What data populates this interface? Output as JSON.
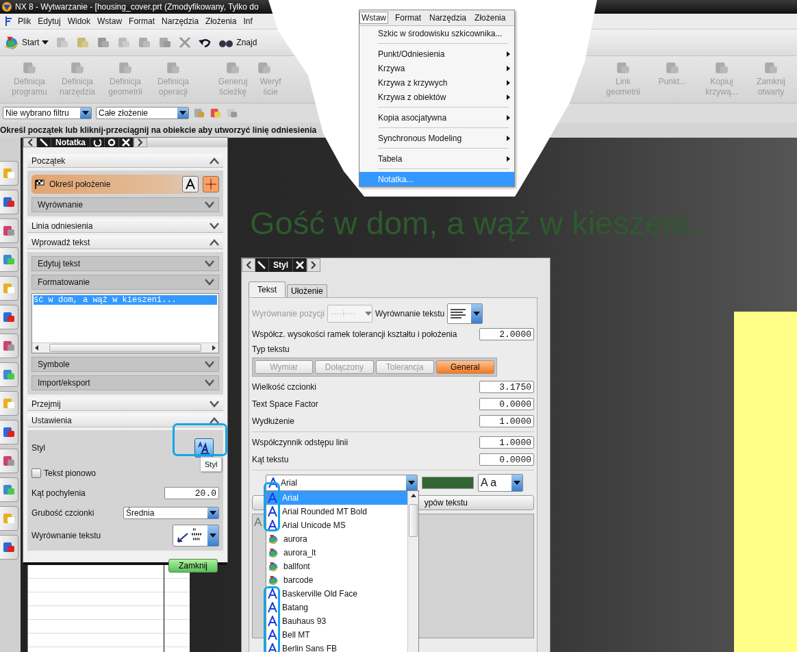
{
  "window": {
    "title": "NX 8 - Wytwarzanie - [housing_cover.prt (Zmodyfikowany, Tylko do"
  },
  "menu_bar": [
    "Plik",
    "Edytuj",
    "Widok",
    "Wstaw",
    "Format",
    "Narzędzia",
    "Złożenia",
    "Inf"
  ],
  "toolbar": {
    "start": "Start",
    "find": "Znajd"
  },
  "operations_toolbar": [
    {
      "label": "Definicja programu",
      "disabled": true
    },
    {
      "label": "Definicja narzędzia",
      "disabled": true
    },
    {
      "label": "Definicja geometrii",
      "disabled": true
    },
    {
      "label": "Definicja operacji",
      "disabled": true
    },
    {
      "label": "Generuj ścieżkę",
      "disabled": true
    },
    {
      "label": "Weryf ście",
      "disabled": true
    }
  ],
  "geometry_toolbar": [
    {
      "label": "Link geometrii",
      "disabled": true
    },
    {
      "label": "Punkt...",
      "disabled": true
    },
    {
      "label": "Kopiuj krzywą...",
      "disabled": true
    },
    {
      "label": "Zamknij otwarty",
      "disabled": true
    }
  ],
  "filter_bar": {
    "type_filter": "Nie wybrano filtru",
    "scope": "Całe złożenie"
  },
  "cue_line": "Określ początek lub kliknij-przeciągnij na obiekcie aby utworzyć linię odniesienia",
  "insert_menu": {
    "menu_bar": [
      {
        "label": "Wstaw",
        "selected": true
      },
      {
        "label": "Format",
        "selected": false
      },
      {
        "label": "Narzędzia",
        "selected": false
      },
      {
        "label": "Złożenia",
        "selected": false
      }
    ],
    "items": [
      {
        "kind": "item",
        "label": "Szkic w środowisku szkicownika...",
        "submenu": false,
        "selected": false
      },
      {
        "kind": "separator"
      },
      {
        "kind": "item",
        "label": "Punkt/Odniesienia",
        "submenu": true,
        "selected": false
      },
      {
        "kind": "item",
        "label": "Krzywa",
        "submenu": true,
        "selected": false
      },
      {
        "kind": "item",
        "label": "Krzywa z krzywych",
        "submenu": true,
        "selected": false
      },
      {
        "kind": "item",
        "label": "Krzywa z obiektów",
        "submenu": true,
        "selected": false
      },
      {
        "kind": "separator"
      },
      {
        "kind": "item",
        "label": "Kopia asocjatywna",
        "submenu": true,
        "selected": false
      },
      {
        "kind": "separator"
      },
      {
        "kind": "item",
        "label": "Synchronous Modeling",
        "submenu": true,
        "selected": false
      },
      {
        "kind": "separator"
      },
      {
        "kind": "item",
        "label": "Tabela",
        "submenu": true,
        "selected": false
      },
      {
        "kind": "separator"
      },
      {
        "kind": "item",
        "label": "Notatka...",
        "submenu": false,
        "selected": true
      }
    ]
  },
  "canvas_text": "Gość w dom, a wąż w kieszeni...",
  "note_dialog": {
    "title": "Notatka",
    "origin": {
      "title": "Początek",
      "expanded": true,
      "specify_location": "Określ położenie",
      "alignment": {
        "title": "Wyrównanie",
        "expanded": false
      }
    },
    "leader": {
      "title": "Linia odniesienia",
      "expanded": false
    },
    "text_input": {
      "title": "Wprowadź tekst",
      "expanded": true,
      "edit_text": {
        "title": "Edytuj tekst",
        "expanded": false
      },
      "formatting": {
        "title": "Formatowanie",
        "expanded": false
      },
      "text": "ść w dom, a wąż w kieszeni...",
      "symbols": {
        "title": "Symbole",
        "expanded": false
      },
      "import_export": {
        "title": "Import/eksport",
        "expanded": false
      }
    },
    "inherit": {
      "title": "Przejmij",
      "expanded": false
    },
    "settings": {
      "title": "Ustawienia",
      "expanded": true,
      "style_label": "Styl",
      "style_tooltip": "Styl",
      "vertical_text": {
        "label": "Tekst pionowo",
        "checked": false
      },
      "slant_angle": {
        "label": "Kąt pochylenia",
        "value": "20.0"
      },
      "font_weight": {
        "label": "Grubość czcionki",
        "value": "Średnia"
      },
      "text_alignment": {
        "label": "Wyrównanie tekstu"
      }
    },
    "close_button": "Zamknij"
  },
  "style_dialog": {
    "title": "Styl",
    "tabs": [
      {
        "label": "Tekst",
        "selected": true
      },
      {
        "label": "Ułożenie",
        "selected": false
      }
    ],
    "position_alignment": {
      "label": "Wyrównanie pozycji",
      "disabled": true
    },
    "text_alignment_label": "Wyrównanie tekstu",
    "frame_height": {
      "label": "Współcz. wysokości ramek tolerancji kształtu i położenia",
      "value": "2.0000"
    },
    "text_type": {
      "label": "Typ tekstu",
      "options": [
        {
          "label": "Wymiar",
          "selected": false,
          "disabled": true
        },
        {
          "label": "Dołączony",
          "selected": false,
          "disabled": true
        },
        {
          "label": "Tolerancja",
          "selected": false,
          "disabled": true
        },
        {
          "label": "General",
          "selected": true,
          "disabled": false
        }
      ]
    },
    "fields": [
      {
        "label": "Wielkość czcionki",
        "value": "3.1750"
      },
      {
        "label": "Text Space Factor",
        "value": "0.0000"
      },
      {
        "label": "Wydłużenie",
        "value": "1.0000"
      }
    ],
    "fields2": [
      {
        "label": "Współczynnik odstępu linii",
        "value": "1.0000"
      },
      {
        "label": "Kąt tekstu",
        "value": "0.0000"
      }
    ],
    "font": "Arial",
    "case_value": "A a",
    "apply_button": "ypów tekstu",
    "preview_text": "A",
    "font_list": [
      {
        "name": "Arial",
        "kind": "truetype",
        "selected": true
      },
      {
        "name": "Arial Rounded MT Bold",
        "kind": "truetype",
        "selected": false
      },
      {
        "name": "Arial Unicode MS",
        "kind": "truetype",
        "selected": false
      },
      {
        "name": "aurora",
        "kind": "nx",
        "selected": false
      },
      {
        "name": "aurora_lt",
        "kind": "nx",
        "selected": false
      },
      {
        "name": "ballfont",
        "kind": "nx",
        "selected": false
      },
      {
        "name": "barcode",
        "kind": "nx",
        "selected": false
      },
      {
        "name": "Baskerville Old Face",
        "kind": "truetype",
        "selected": false
      },
      {
        "name": "Batang",
        "kind": "truetype",
        "selected": false
      },
      {
        "name": "Bauhaus 93",
        "kind": "truetype",
        "selected": false
      },
      {
        "name": "Bell MT",
        "kind": "truetype",
        "selected": false
      },
      {
        "name": "Berlin Sans FB",
        "kind": "truetype",
        "selected": false
      }
    ]
  }
}
